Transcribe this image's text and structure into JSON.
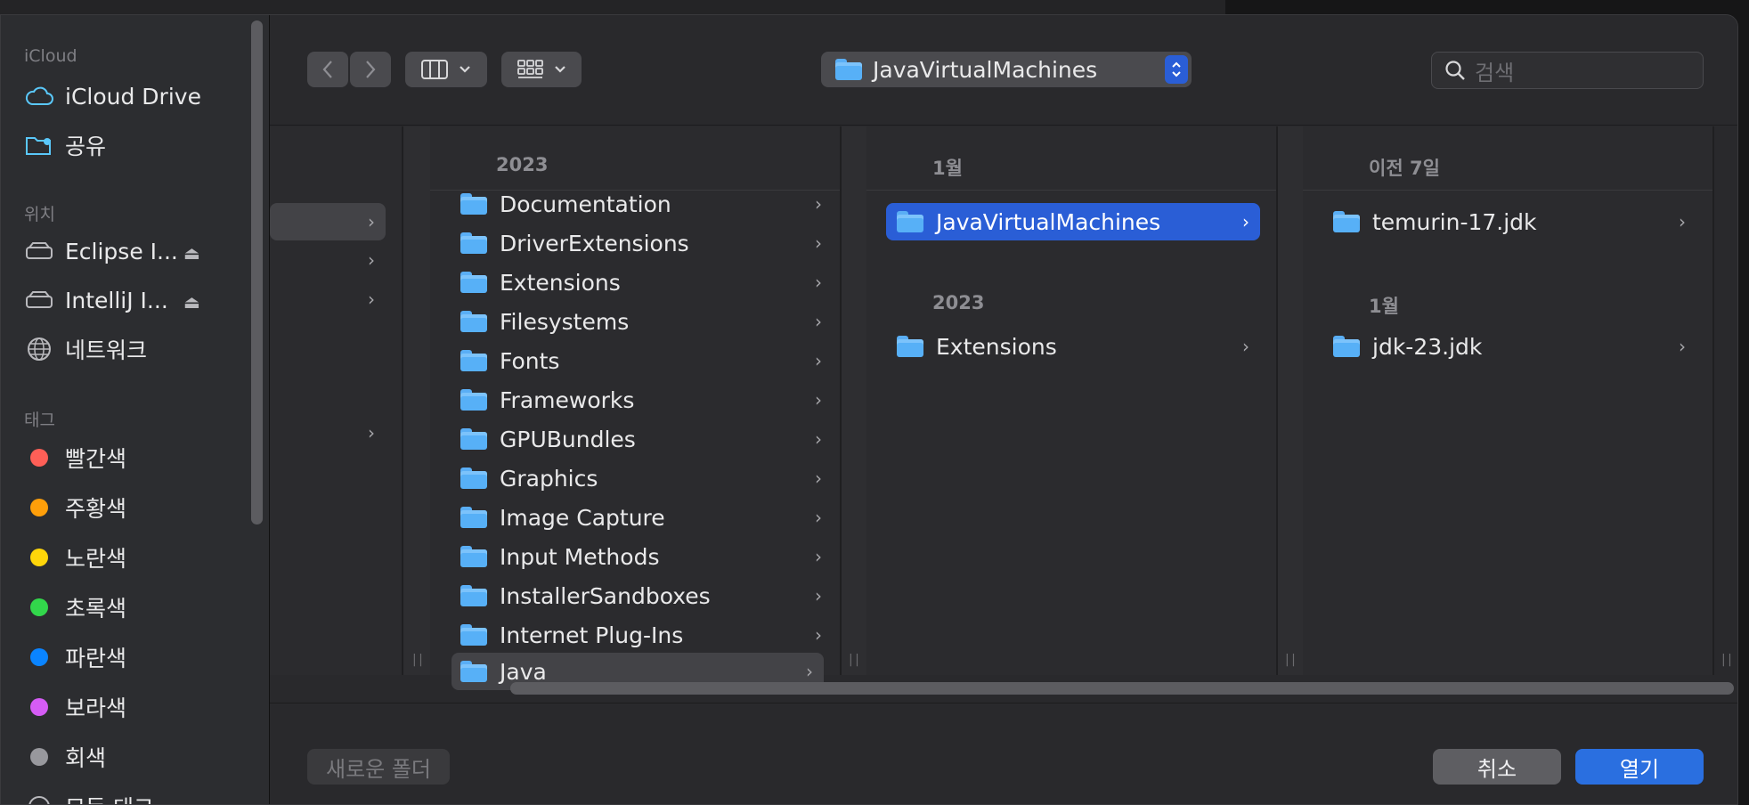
{
  "sidebar": {
    "sections": {
      "icloud": "iCloud",
      "locations": "위치",
      "tags": "태그"
    },
    "icloud_items": [
      {
        "label": "iCloud Drive",
        "icon": "cloud-icon"
      },
      {
        "label": "공유",
        "icon": "shared-folder-icon"
      }
    ],
    "location_items": [
      {
        "label": "Eclipse I...",
        "icon": "drive-icon"
      },
      {
        "label": "IntelliJ I...",
        "icon": "drive-icon"
      },
      {
        "label": "네트워크",
        "icon": "globe-icon"
      }
    ],
    "tag_items": [
      {
        "label": "빨간색",
        "color": "#ff5f57"
      },
      {
        "label": "주황색",
        "color": "#ff9f0a"
      },
      {
        "label": "노란색",
        "color": "#ffd60a"
      },
      {
        "label": "초록색",
        "color": "#32d74b"
      },
      {
        "label": "파란색",
        "color": "#0a84ff"
      },
      {
        "label": "보라색",
        "color": "#d55cf5"
      },
      {
        "label": "회색",
        "color": "#98989d"
      },
      {
        "label": "모든 태그...",
        "color": ""
      }
    ]
  },
  "toolbar": {
    "path_label": "JavaVirtualMachines",
    "search_placeholder": "검색"
  },
  "columns": {
    "col2": {
      "header": "2023",
      "items": [
        "Documentation",
        "DriverExtensions",
        "Extensions",
        "Filesystems",
        "Fonts",
        "Frameworks",
        "GPUBundles",
        "Graphics",
        "Image Capture",
        "Input Methods",
        "InstallerSandboxes",
        "Internet Plug-Ins",
        "Java"
      ]
    },
    "col3": {
      "header_recent": "1월",
      "selected": "JavaVirtualMachines",
      "header_year": "2023",
      "other": "Extensions"
    },
    "col4": {
      "header_prev": "이전 7일",
      "item_prev": "temurin-17.jdk",
      "header_month": "1월",
      "item_month": "jdk-23.jdk"
    }
  },
  "footer": {
    "new_folder": "새로운 폴더",
    "cancel": "취소",
    "open": "열기"
  },
  "colors": {
    "accent": "#2a5ed6",
    "folder": "#57b0f7"
  }
}
